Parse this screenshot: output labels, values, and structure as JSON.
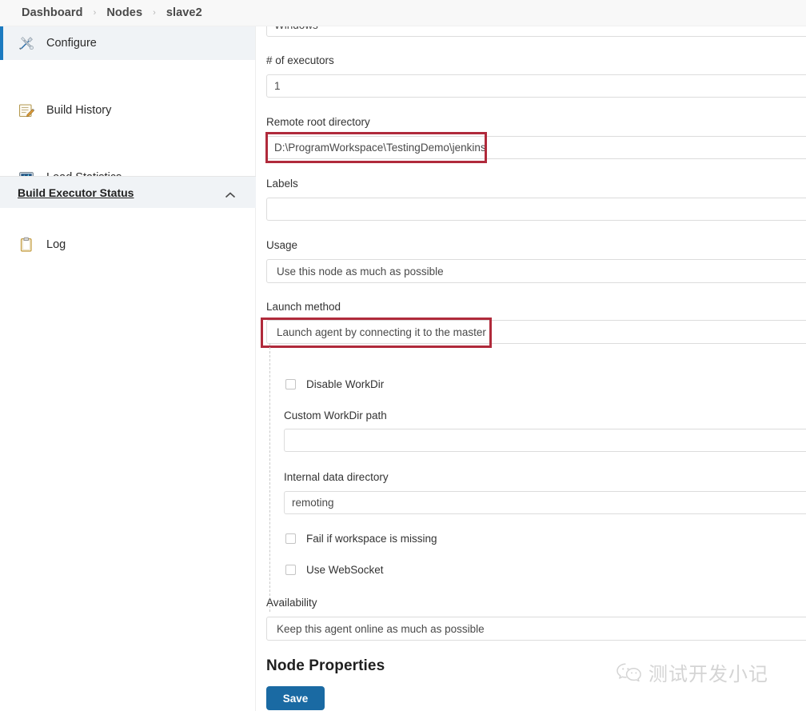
{
  "breadcrumb": {
    "items": [
      "Dashboard",
      "Nodes",
      "slave2"
    ],
    "separator": "›"
  },
  "sidebar": {
    "items": [
      {
        "label": "Configure",
        "icon": "wrench-screwdriver-icon",
        "active": true
      },
      {
        "label": "Build History",
        "icon": "notepad-pencil-icon",
        "active": false
      },
      {
        "label": "Load Statistics",
        "icon": "monitor-chart-icon",
        "active": false
      },
      {
        "label": "Log",
        "icon": "clipboard-icon",
        "active": false
      }
    ],
    "executor_status": {
      "label": "Build Executor Status",
      "chevron": "chevron-up-icon"
    }
  },
  "form": {
    "description_field": {
      "value": "Windows",
      "clipped": true
    },
    "executors": {
      "label": "# of executors",
      "value": "1"
    },
    "remote_root": {
      "label": "Remote root directory",
      "value": "D:\\ProgramWorkspace\\TestingDemo\\jenkins",
      "highlighted": true
    },
    "labels": {
      "label": "Labels",
      "value": ""
    },
    "usage": {
      "label": "Usage",
      "value": "Use this node as much as possible"
    },
    "launch_method": {
      "label": "Launch method",
      "value": "Launch agent by connecting it to the master",
      "highlighted": true
    },
    "workdir": {
      "disable_workdir": {
        "label": "Disable WorkDir",
        "checked": false
      },
      "custom_workdir_path": {
        "label": "Custom WorkDir path",
        "value": ""
      },
      "internal_data_directory": {
        "label": "Internal data directory",
        "value": "remoting"
      },
      "fail_if_workspace_missing": {
        "label": "Fail if workspace is missing",
        "checked": false
      },
      "use_websocket": {
        "label": "Use WebSocket",
        "checked": false
      }
    },
    "availability": {
      "label": "Availability",
      "value": "Keep this agent online as much as possible"
    },
    "node_properties_title": "Node Properties",
    "save_label": "Save"
  },
  "watermark": {
    "text": "测试开发小记",
    "icon": "wechat-icon"
  },
  "colors": {
    "accent_blue": "#1b7ac0",
    "save_blue": "#1a6aa3",
    "annotation_red": "#b02a3b",
    "sidebar_active_bg": "#f0f3f6",
    "header_bg": "#f8f8f8",
    "input_border": "#dcdcdc"
  }
}
